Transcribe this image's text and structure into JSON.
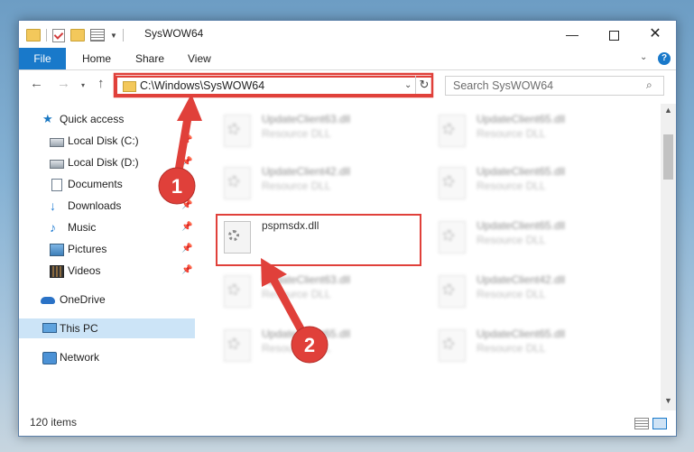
{
  "window": {
    "title": "SysWOW64",
    "controls": {
      "minimize": "—",
      "maximize": "",
      "close": "✕"
    }
  },
  "ribbon": {
    "tabs": [
      "File",
      "Home",
      "Share",
      "View"
    ],
    "help": "?"
  },
  "nav_buttons": {
    "back": "←",
    "forward": "→",
    "recent": "▾",
    "up": "↑"
  },
  "address": {
    "path": "C:\\Windows\\SysWOW64",
    "dropdown": "⌄",
    "refresh": "↻"
  },
  "search": {
    "placeholder": "Search SysWOW64",
    "icon": "⌕"
  },
  "sidebar": {
    "items": [
      {
        "label": "Quick access",
        "icon": "star-icon",
        "pinned": false
      },
      {
        "label": "Local Disk (C:)",
        "icon": "drive-icon",
        "pinned": true
      },
      {
        "label": "Local Disk (D:)",
        "icon": "drive-icon",
        "pinned": true
      },
      {
        "label": "Documents",
        "icon": "documents-icon",
        "pinned": true
      },
      {
        "label": "Downloads",
        "icon": "downloads-icon",
        "pinned": true
      },
      {
        "label": "Music",
        "icon": "music-icon",
        "pinned": true
      },
      {
        "label": "Pictures",
        "icon": "pictures-icon",
        "pinned": true
      },
      {
        "label": "Videos",
        "icon": "videos-icon",
        "pinned": true
      },
      {
        "label": "OneDrive",
        "icon": "onedrive-icon",
        "pinned": false
      },
      {
        "label": "This PC",
        "icon": "this-pc-icon",
        "pinned": false,
        "selected": true
      },
      {
        "label": "Network",
        "icon": "network-icon",
        "pinned": false
      }
    ],
    "pin_glyph": "📌"
  },
  "files": [
    {
      "name": "UpdateClient63.dll",
      "type": "Resource DLL"
    },
    {
      "name": "UpdateClient65.dll",
      "type": "Resource DLL"
    },
    {
      "name": "UpdateClient42.dll",
      "type": "Resource DLL"
    },
    {
      "name": "UpdateClient65.dll",
      "type": "Resource DLL"
    },
    {
      "name": "pspmsdx.dll",
      "type": ""
    },
    {
      "name": "UpdateClient65.dll",
      "type": "Resource DLL"
    },
    {
      "name": "UpdateClient63.dll",
      "type": "Resource DLL"
    },
    {
      "name": "UpdateClient42.dll",
      "type": "Resource DLL"
    },
    {
      "name": "UpdateClient65.dll",
      "type": "Resource DLL"
    },
    {
      "name": "UpdateClient65.dll",
      "type": "Resource DLL"
    }
  ],
  "status": {
    "item_count": "120 items"
  },
  "annotations": {
    "step1": "1",
    "step2": "2"
  },
  "colors": {
    "accent": "#1979ca",
    "highlight_red": "#e0403a",
    "selected_nav": "#cce4f7"
  }
}
